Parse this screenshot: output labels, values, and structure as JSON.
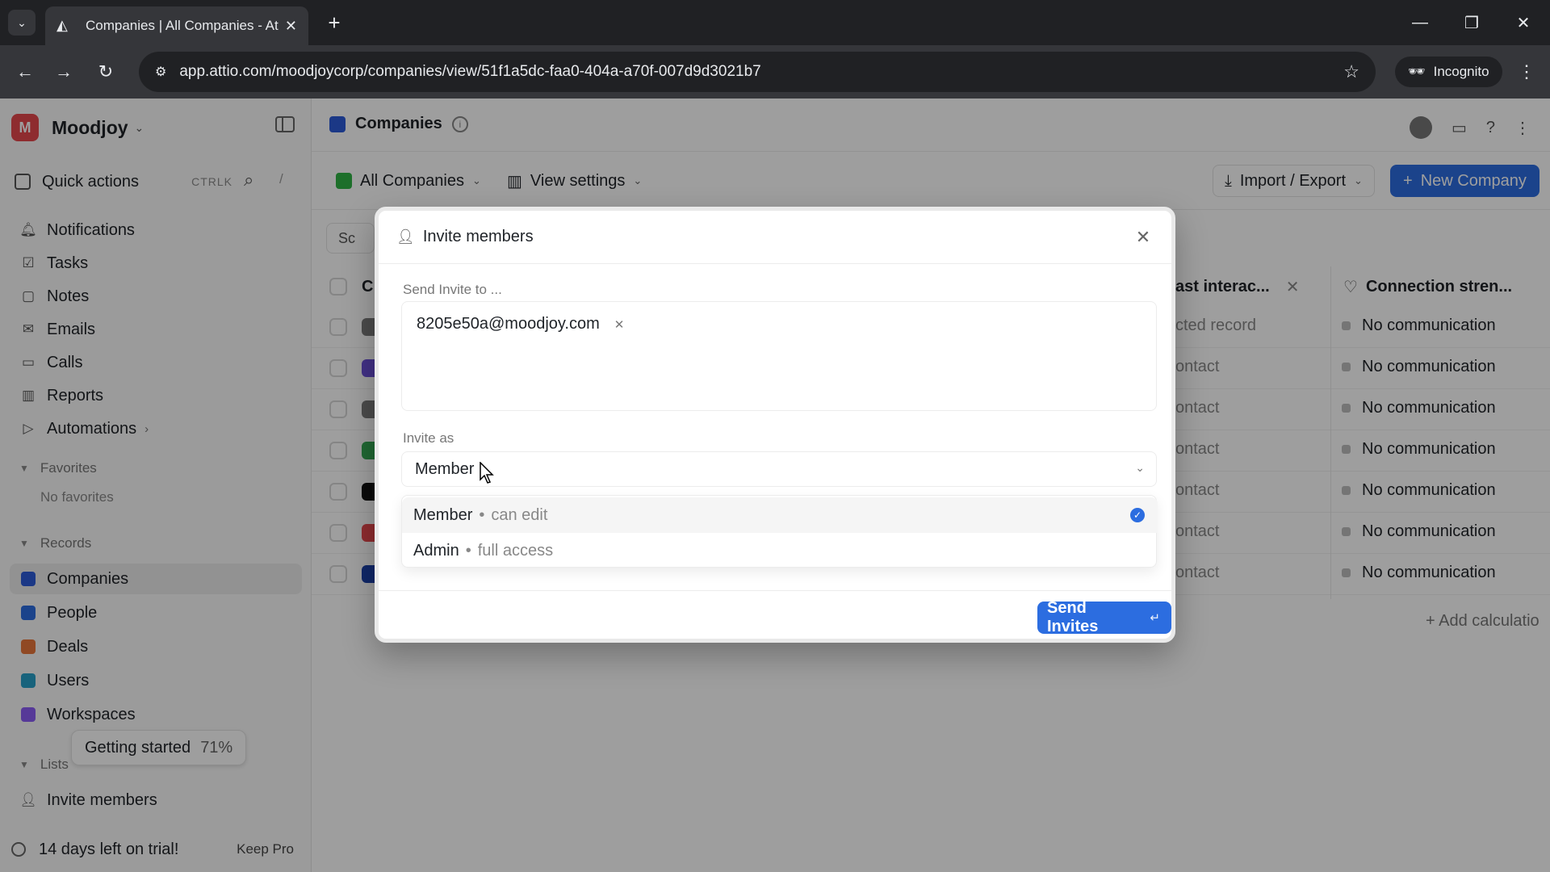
{
  "browser": {
    "tab_title": "Companies | All Companies - At",
    "url": "app.attio.com/moodjoycorp/companies/view/51f1a5dc-faa0-404a-a70f-007d9d3021b7",
    "incognito_label": "Incognito"
  },
  "sidebar": {
    "workspace_initial": "M",
    "workspace_name": "Moodjoy",
    "quick_actions": {
      "label": "Quick actions",
      "shortcut": "CTRLK",
      "slash": "/"
    },
    "nav": [
      {
        "label": "Notifications",
        "icon": "bell-icon"
      },
      {
        "label": "Tasks",
        "icon": "checkbox-icon"
      },
      {
        "label": "Notes",
        "icon": "note-icon"
      },
      {
        "label": "Emails",
        "icon": "mail-icon"
      },
      {
        "label": "Calls",
        "icon": "video-icon"
      },
      {
        "label": "Reports",
        "icon": "chart-icon"
      },
      {
        "label": "Automations",
        "icon": "play-icon"
      }
    ],
    "favorites": {
      "heading": "Favorites",
      "empty": "No favorites"
    },
    "records": {
      "heading": "Records",
      "items": [
        {
          "label": "Companies",
          "color": "#2c5bd8"
        },
        {
          "label": "People",
          "color": "#2c6de0"
        },
        {
          "label": "Deals",
          "color": "#e8763a"
        },
        {
          "label": "Users",
          "color": "#27a1c9"
        },
        {
          "label": "Workspaces",
          "color": "#8b5cf6"
        }
      ]
    },
    "getting_started": {
      "label": "Getting started",
      "percent": "71%"
    },
    "lists_heading": "Lists",
    "invite_members": "Invite members",
    "trial": {
      "label": "14 days left on trial!",
      "action": "Keep Pro"
    }
  },
  "main": {
    "title": "Companies",
    "view": {
      "name": "All Companies",
      "settings": "View settings"
    },
    "import_export": "Import / Export",
    "new_company": "New Company",
    "sort_label": "Sc",
    "table": {
      "first_col_stub": "C",
      "col_last_interaction": "ast interac...",
      "col_connection": "Connection stren...",
      "rows": [
        {
          "interaction": "cted record",
          "connection": "No communication",
          "logo": "#7a7a7a"
        },
        {
          "interaction": "ontact",
          "connection": "No communication",
          "logo": "#6b4fd8"
        },
        {
          "interaction": "ontact",
          "connection": "No communication",
          "logo": "#7a7a7a"
        },
        {
          "interaction": "ontact",
          "connection": "No communication",
          "logo": "#34a853"
        },
        {
          "interaction": "ontact",
          "connection": "No communication",
          "logo": "#111111"
        },
        {
          "interaction": "ontact",
          "connection": "No communication",
          "logo": "#e5484d"
        },
        {
          "interaction": "ontact",
          "connection": "No communication",
          "logo": "#1a3fa8"
        }
      ],
      "add_calculation": "+ Add calculatio"
    }
  },
  "modal": {
    "title": "Invite members",
    "send_to_label": "Send Invite to ...",
    "email": "8205e50a@moodjoy.com",
    "invite_as_label": "Invite as",
    "selected_role": "Member",
    "options": [
      {
        "role": "Member",
        "desc": "can edit",
        "selected": true
      },
      {
        "role": "Admin",
        "desc": "full access",
        "selected": false
      }
    ],
    "bullet": "•",
    "send_button": "Send Invites"
  },
  "colors": {
    "accent": "#2c6de0",
    "workspace": "#e5484d"
  }
}
